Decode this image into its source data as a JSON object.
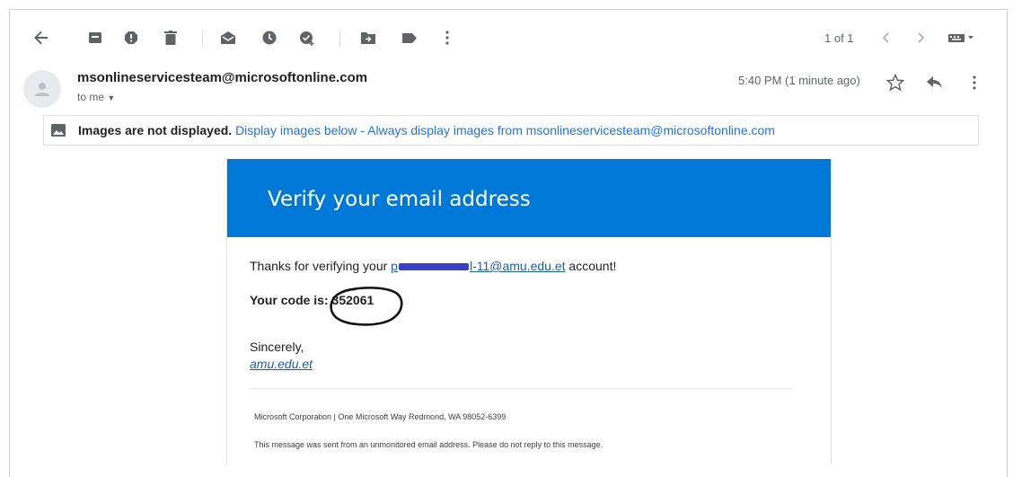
{
  "toolbar": {
    "icons": [
      "back-arrow-icon",
      "archive-icon",
      "report-spam-icon",
      "delete-icon",
      "mark-unread-icon",
      "snooze-icon",
      "add-to-tasks-icon",
      "move-to-icon",
      "label-icon",
      "more-vert-icon"
    ],
    "pager_text": "1 of 1"
  },
  "message": {
    "sender": "msonlineservicesteam@microsoftonline.com",
    "recipient_label": "to me",
    "time": "5:40 PM (1 minute ago)"
  },
  "images_notice": {
    "bold": "Images are not displayed.",
    "display_link": "Display images below",
    "separator": " - ",
    "always_link": "Always display images from msonlineservicesteam@microsoftonline.com"
  },
  "email": {
    "banner_title": "Verify your email address",
    "thanks_prefix": "Thanks for verifying your ",
    "email_prefix_visible": "p",
    "email_suffix_visible": "l-11@amu.edu.et",
    "thanks_suffix": " account!",
    "code_label": "Your code is: ",
    "code": "352061",
    "sincerely": "Sincerely,",
    "signature": "amu.edu.et",
    "footer_address": "Microsoft Corporation | One Microsoft Way Redmond, WA 98052-6399",
    "footer_note": "This message was sent from an unmonitored email address. Please do not reply to this message."
  },
  "colors": {
    "banner": "#0078d7",
    "link": "#1a73e8",
    "redaction": "#3a40c8"
  }
}
